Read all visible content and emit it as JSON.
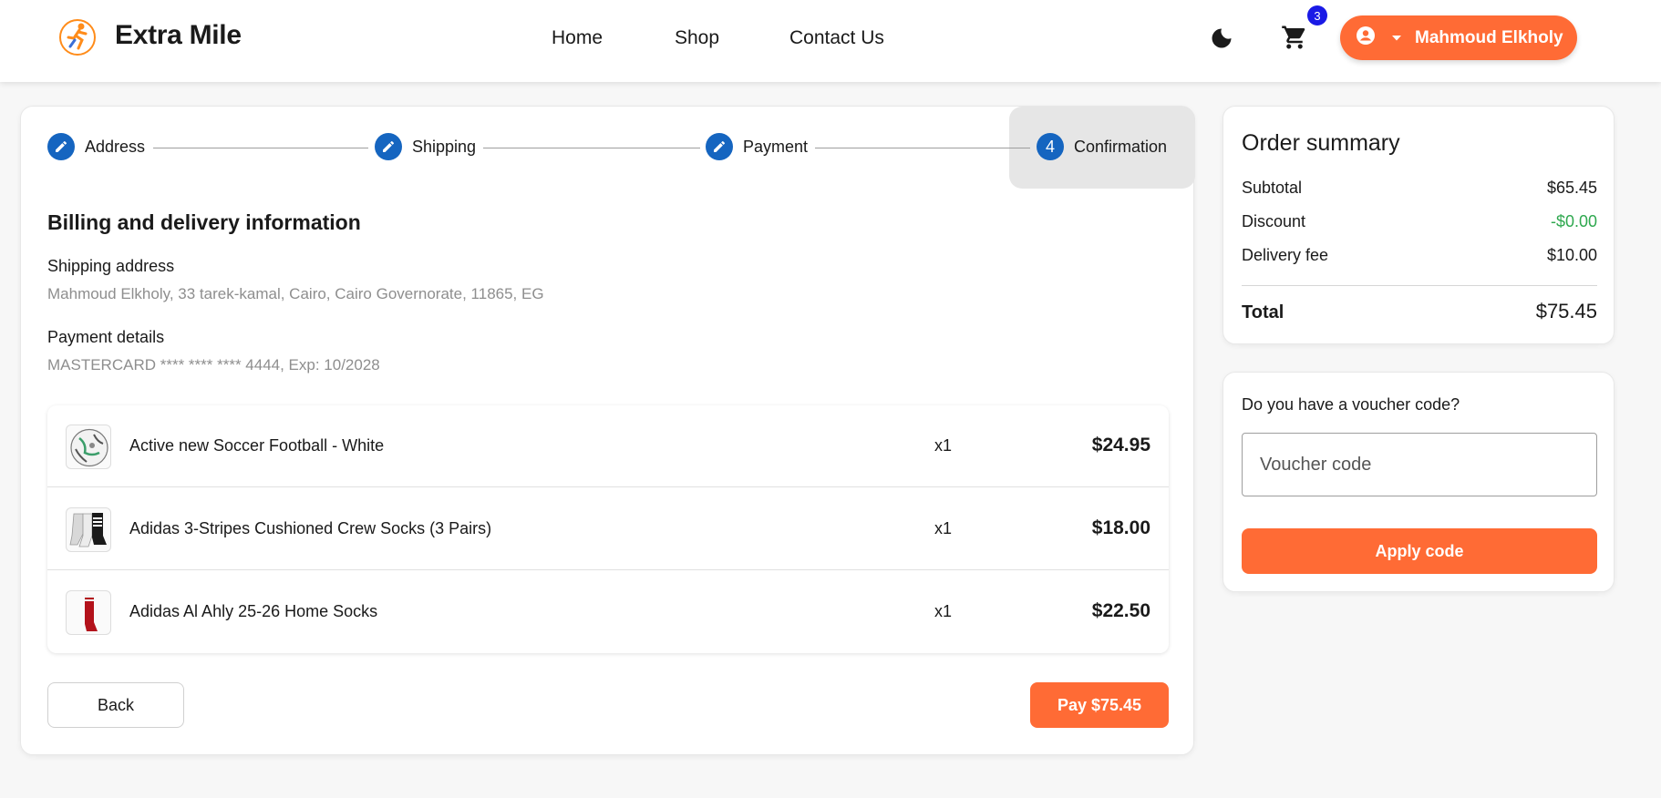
{
  "header": {
    "brand": "Extra Mile",
    "nav": [
      "Home",
      "Shop",
      "Contact Us"
    ],
    "cart_count": "3",
    "user_name": "Mahmoud Elkholy",
    "icons": {
      "logo": "runner-logo-icon",
      "theme": "moon-icon",
      "cart": "cart-icon",
      "user": "account-circle-icon",
      "dropdown": "caret-down-icon"
    }
  },
  "stepper": {
    "steps": [
      {
        "label": "Address",
        "marker": "edit-icon"
      },
      {
        "label": "Shipping",
        "marker": "edit-icon"
      },
      {
        "label": "Payment",
        "marker": "edit-icon"
      },
      {
        "label": "Confirmation",
        "number": "4"
      }
    ],
    "active_index": 3,
    "color": "#1565c0"
  },
  "billing": {
    "title": "Billing and delivery information",
    "shipping_label": "Shipping address",
    "shipping_value": "Mahmoud Elkholy, 33 tarek-kamal, Cairo, Cairo Governorate, 11865, EG",
    "payment_label": "Payment details",
    "payment_value": "MASTERCARD **** **** **** 4444, Exp: 10/2028"
  },
  "items": [
    {
      "name": "Active new Soccer Football - White",
      "qty": "x1",
      "price": "$24.95",
      "thumb": "soccer-ball"
    },
    {
      "name": "Adidas 3-Stripes Cushioned Crew Socks (3 Pairs)",
      "qty": "x1",
      "price": "$18.00",
      "thumb": "crew-socks"
    },
    {
      "name": "Adidas Al Ahly 25-26 Home Socks",
      "qty": "x1",
      "price": "$22.50",
      "thumb": "red-socks"
    }
  ],
  "actions": {
    "back_label": "Back",
    "pay_label": "Pay $75.45"
  },
  "summary": {
    "title": "Order summary",
    "subtotal_label": "Subtotal",
    "subtotal": "$65.45",
    "discount_label": "Discount",
    "discount": "-$0.00",
    "delivery_label": "Delivery fee",
    "delivery": "$10.00",
    "total_label": "Total",
    "total": "$75.45"
  },
  "voucher": {
    "question": "Do you have a voucher code?",
    "placeholder": "Voucher code",
    "value": "",
    "apply_label": "Apply code"
  },
  "colors": {
    "accent": "#ff6b35",
    "step_blue": "#1565c0",
    "discount_green": "#2fa84f",
    "badge_blue": "#1a1ae6"
  }
}
